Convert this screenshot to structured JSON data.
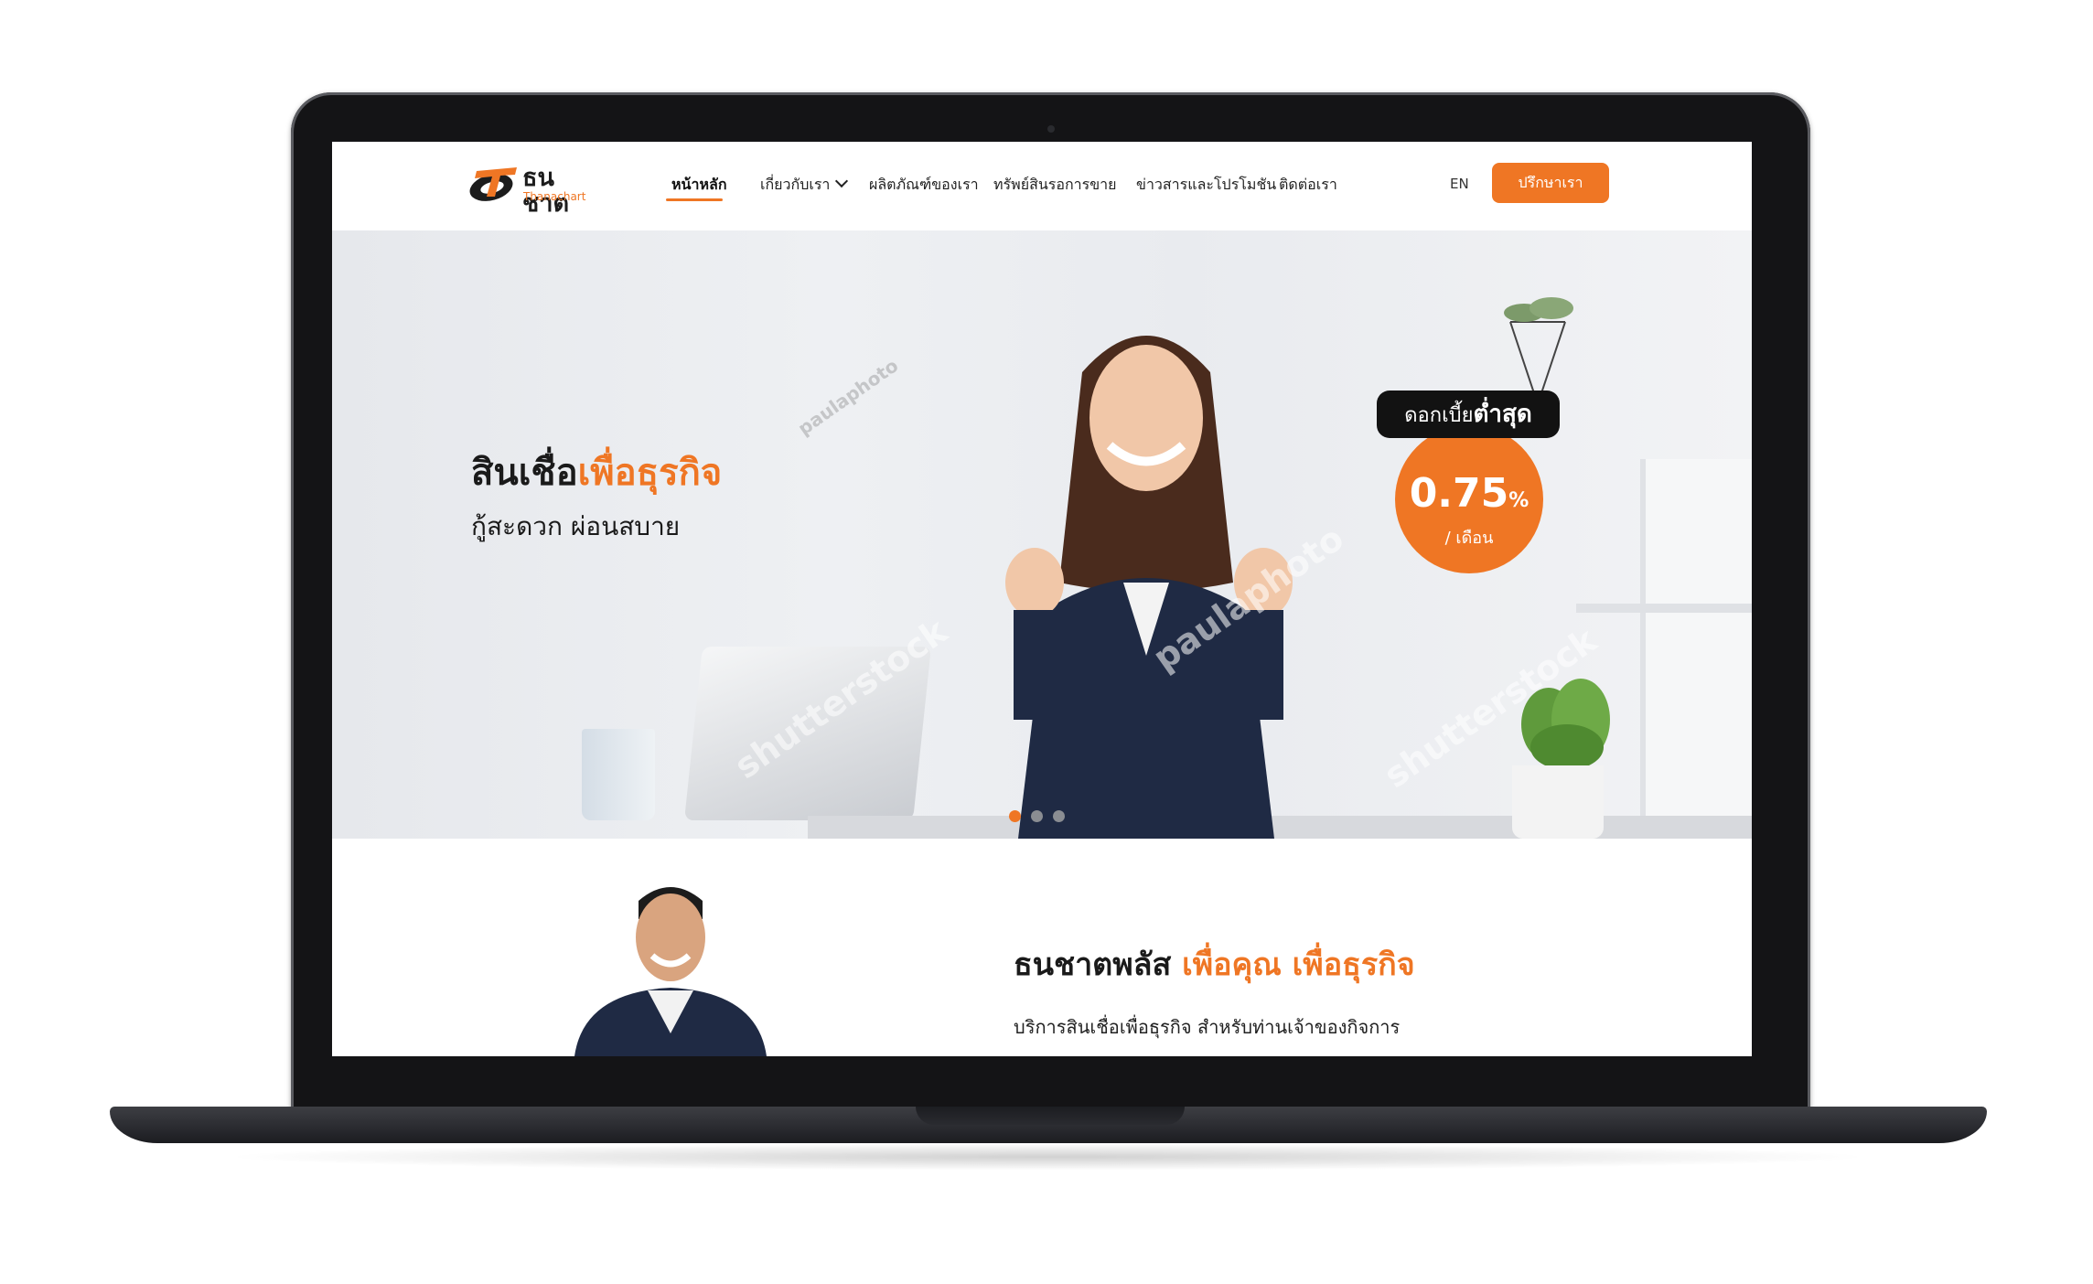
{
  "header": {
    "logo_th": "ธนชาต",
    "logo_en": "Thanachart",
    "nav": [
      {
        "label": "หน้าหลัก"
      },
      {
        "label": "เกี่ยวกับเรา"
      },
      {
        "label": "ผลิตภัณฑ์ของเรา"
      },
      {
        "label": "ทรัพย์สินรอการขาย"
      },
      {
        "label": "ข่าวสารและโปรโมชัน"
      },
      {
        "label": "ติดต่อเรา"
      }
    ],
    "lang": "EN",
    "cta": "ปรึกษาเรา"
  },
  "hero": {
    "title_part1": "สินเชื่อ",
    "title_part2": "เพื่อธุรกิจ",
    "subtitle": "กู้สะดวก ผ่อนสบาย",
    "rate": {
      "label_part1": "ดอกเบี้ย",
      "label_part2": "ต่ำสุด",
      "value": "0.75",
      "percent": "%",
      "unit": "/ เดือน"
    },
    "slides": 3,
    "active_slide": 1,
    "watermarks": [
      "shutterstock",
      "paulaphoto"
    ]
  },
  "section2": {
    "title_part1": "ธนชาตพลัส ",
    "title_part2": "เพื่อคุณ เพื่อธุรกิจ",
    "text": "บริการสินเชื่อเพื่อธุรกิจ สำหรับท่านเจ้าของกิจการ"
  },
  "colors": {
    "accent": "#ef7624",
    "dark": "#121212",
    "laptop_frame": "#141416"
  }
}
